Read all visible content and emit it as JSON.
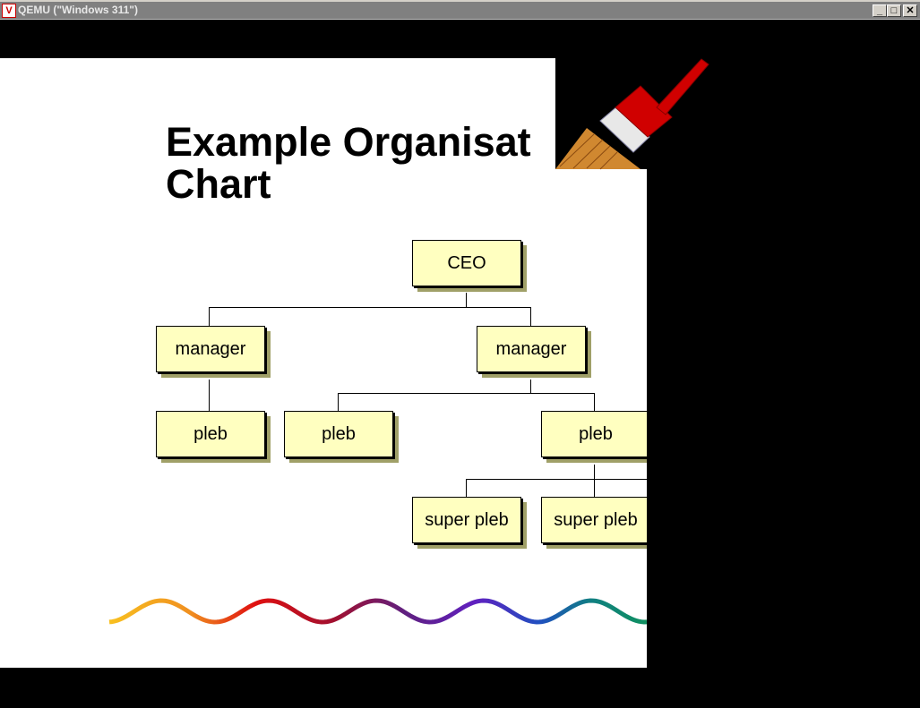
{
  "window": {
    "title": "QEMU (\"Windows 311\")",
    "icon": "qemu-icon",
    "controls": [
      "minimize",
      "maximize",
      "close"
    ]
  },
  "slide": {
    "title_line1": "Example Organisat",
    "title_line2": "Chart",
    "nodes": {
      "ceo": "CEO",
      "manager1": "manager",
      "manager2": "manager",
      "pleb1": "pleb",
      "pleb2": "pleb",
      "pleb3": "pleb",
      "super1": "super pleb",
      "super2": "super pleb"
    },
    "decorations": [
      "paintbrush-icon",
      "rainbow-wave"
    ],
    "colors": {
      "box_fill": "#ffffc0",
      "box_shadow": "#a0a068",
      "brush_red": "#d00000"
    }
  }
}
